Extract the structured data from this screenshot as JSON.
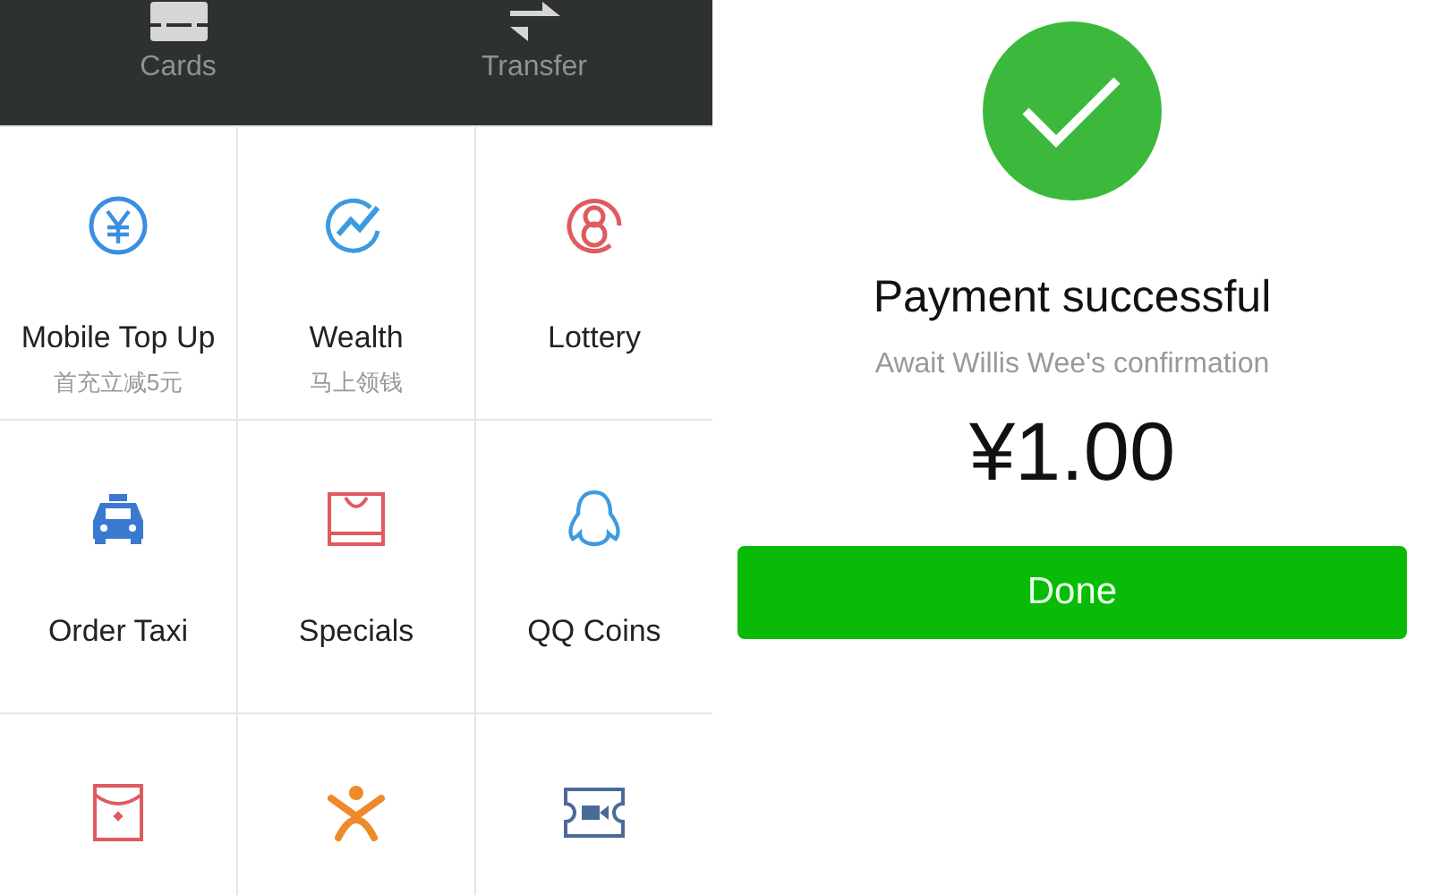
{
  "top_bar": {
    "items": [
      {
        "label": "Cards",
        "kind": "card"
      },
      {
        "label": "Transfer",
        "kind": "transfer"
      }
    ]
  },
  "services": [
    {
      "label": "Mobile Top Up",
      "subtitle": "首充立减5元",
      "kind": "yen"
    },
    {
      "label": "Wealth",
      "subtitle": "马上领钱",
      "kind": "wealth"
    },
    {
      "label": "Lottery",
      "kind": "lottery"
    },
    {
      "label": "Order Taxi",
      "kind": "taxi"
    },
    {
      "label": "Specials",
      "kind": "bag"
    },
    {
      "label": "QQ Coins",
      "kind": "penguin"
    },
    {
      "kind": "envelope"
    },
    {
      "kind": "person"
    },
    {
      "kind": "ticket"
    }
  ],
  "result": {
    "title": "Payment successful",
    "subtitle": "Await Willis Wee's confirmation",
    "amount": "¥1.00",
    "button": "Done"
  }
}
